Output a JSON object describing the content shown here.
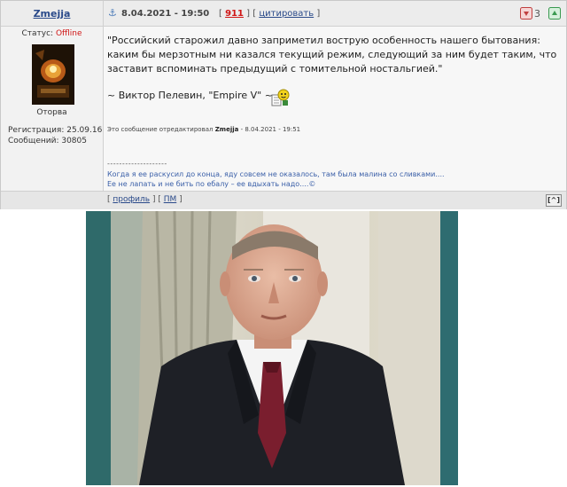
{
  "post": {
    "username": "Zmejja",
    "status_label": "Статус:",
    "status_value": "Offline",
    "rank": "Оторва",
    "registration": "Регистрация: 25.09.16",
    "messages": "Сообщений: 30805",
    "date": "8.04.2021 - 19:50",
    "reply_count": "911",
    "quote_label": "цитировать",
    "vote_count": "3",
    "quote_text": "\"Российский старожил давно заприметил вострую особенность нашего бытования: каким бы мерзотным ни казался текущий режим, следующий за ним будет таким, что заставит вспоминать предыдущий с томительной ностальгией.\"",
    "author": "~ Виктор Пелевин, \"Empire V\" ~",
    "edited_prefix": "Это сообщение отредактировал",
    "edited_user": "Zmejja",
    "edited_date": "- 8.04.2021 - 19:51",
    "sig_divider": "--------------------",
    "sig_line1": "Когда я ее раскусил до конца, яду совсем не оказалось, там была малина со сливками....",
    "sig_line2": "Ее не лапать и не бить по ебалу – ее вдыхать надо....©",
    "footer_profile": "профиль",
    "footer_pm": "ПМ",
    "top_button": "[^]"
  },
  "icons": [
    "anchor-icon",
    "vote-down-icon",
    "vote-up-icon",
    "smiley-icon",
    "avatar-image"
  ],
  "colors": {
    "offline": "#d01616",
    "link": "#2a4a8a",
    "signature": "#3a5fa8"
  }
}
